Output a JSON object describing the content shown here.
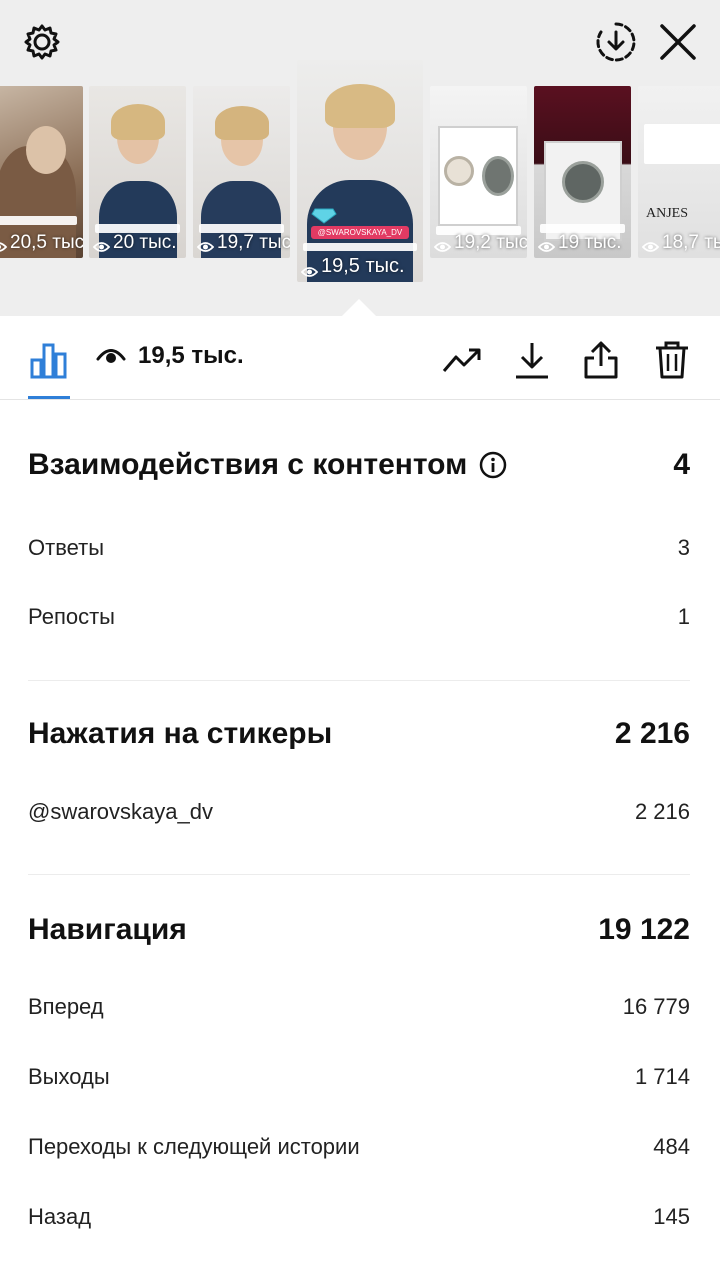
{
  "header": {
    "settings_icon": "gear-icon",
    "download_icon": "download-circle-icon",
    "close_icon": "close-icon"
  },
  "stories": [
    {
      "views": "20,5 тыс."
    },
    {
      "views": "20 тыс."
    },
    {
      "views": "19,7 тыс."
    },
    {
      "views": "19,5 тыс.",
      "tag": "@SWAROVSKAYA_DV",
      "active": true
    },
    {
      "views": "19,2 тыс."
    },
    {
      "views": "19 тыс."
    },
    {
      "views": "18,7 тыс.",
      "brand": "ANJES"
    }
  ],
  "toolbar": {
    "views": "19,5 тыс.",
    "icons": [
      "bar-chart-icon",
      "eye-icon",
      "trending-icon",
      "download-icon",
      "share-icon",
      "trash-icon"
    ]
  },
  "interactions": {
    "title": "Взаимодействия с контентом",
    "total": "4",
    "rows": [
      {
        "label": "Ответы",
        "value": "3"
      },
      {
        "label": "Репосты",
        "value": "1"
      }
    ]
  },
  "stickers": {
    "title": "Нажатия на стикеры",
    "total": "2 216",
    "rows": [
      {
        "label": "@swarovskaya_dv",
        "value": "2 216"
      }
    ]
  },
  "navigation": {
    "title": "Навигация",
    "total": "19 122",
    "rows": [
      {
        "label": "Вперед",
        "value": "16 779"
      },
      {
        "label": "Выходы",
        "value": "1 714"
      },
      {
        "label": "Переходы к следующей истории",
        "value": "484"
      },
      {
        "label": "Назад",
        "value": "145"
      }
    ]
  },
  "colors": {
    "accent": "#2f7fd8",
    "tag": "#e23a63"
  }
}
